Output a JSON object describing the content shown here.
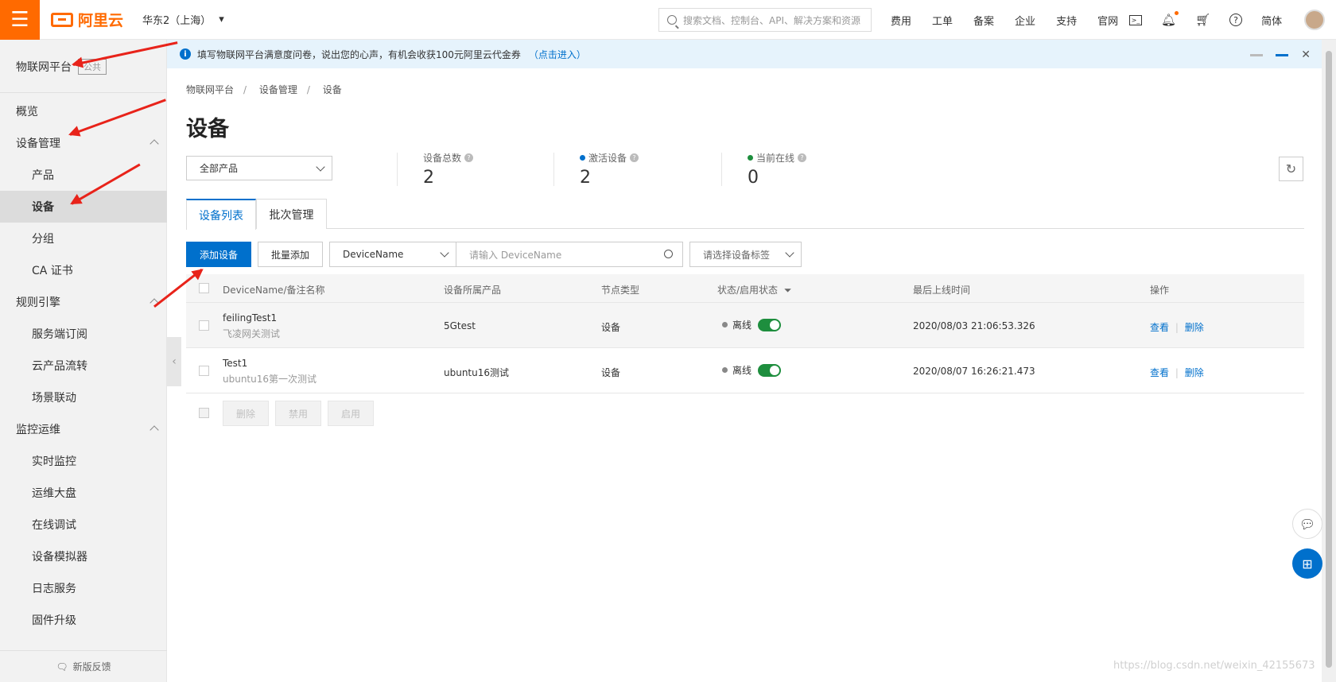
{
  "header": {
    "brand": "阿里云",
    "region": "华东2（上海）",
    "search_placeholder": "搜索文档、控制台、API、解决方案和资源",
    "nav": [
      "费用",
      "工单",
      "备案",
      "企业",
      "支持",
      "官网"
    ],
    "lang": "简体",
    "icons": [
      "terminal-icon",
      "bell-icon",
      "cart-icon",
      "help-icon"
    ]
  },
  "sidebar": {
    "title": "物联网平台",
    "tag": "公共",
    "items": [
      {
        "label": "概览",
        "level": 1
      },
      {
        "label": "设备管理",
        "level": 1,
        "expanded": true
      },
      {
        "label": "产品",
        "level": 2
      },
      {
        "label": "设备",
        "level": 2,
        "active": true
      },
      {
        "label": "分组",
        "level": 2
      },
      {
        "label": "CA 证书",
        "level": 2
      },
      {
        "label": "规则引擎",
        "level": 1,
        "expanded": true
      },
      {
        "label": "服务端订阅",
        "level": 2
      },
      {
        "label": "云产品流转",
        "level": 2
      },
      {
        "label": "场景联动",
        "level": 2
      },
      {
        "label": "监控运维",
        "level": 1,
        "expanded": true
      },
      {
        "label": "实时监控",
        "level": 2
      },
      {
        "label": "运维大盘",
        "level": 2
      },
      {
        "label": "在线调试",
        "level": 2
      },
      {
        "label": "设备模拟器",
        "level": 2
      },
      {
        "label": "日志服务",
        "level": 2
      },
      {
        "label": "固件升级",
        "level": 2
      }
    ],
    "feedback": "新版反馈"
  },
  "notice": {
    "text": "填写物联网平台满意度问卷，说出您的心声，有机会收获100元阿里云代金券",
    "link": "（点击进入）"
  },
  "breadcrumb": [
    "物联网平台",
    "设备管理",
    "设备"
  ],
  "page_title": "设备",
  "product_select": "全部产品",
  "stats": [
    {
      "label": "设备总数",
      "value": "2"
    },
    {
      "label": "激活设备",
      "value": "2",
      "dot_color": "#0070cc"
    },
    {
      "label": "当前在线",
      "value": "0",
      "dot_color": "#1e8e3e"
    }
  ],
  "tabs": [
    "设备列表",
    "批次管理"
  ],
  "toolbar": {
    "add_device": "添加设备",
    "batch_add": "批量添加",
    "filter_field": "DeviceName",
    "search_placeholder": "请输入 DeviceName",
    "tag_placeholder": "请选择设备标签"
  },
  "table": {
    "columns": [
      "DeviceName/备注名称",
      "设备所属产品",
      "节点类型",
      "状态/启用状态",
      "最后上线时间",
      "操作"
    ],
    "rows": [
      {
        "name": "feilingTest1",
        "note": "飞凌网关测试",
        "product": "5Gtest",
        "node": "设备",
        "status": "离线",
        "enabled": true,
        "last_online": "2020/08/03 21:06:53.326",
        "view": "查看",
        "delete": "删除"
      },
      {
        "name": "Test1",
        "note": "ubuntu16第一次测试",
        "product": "ubuntu16测试",
        "node": "设备",
        "status": "离线",
        "enabled": true,
        "last_online": "2020/08/07 16:26:21.473",
        "view": "查看",
        "delete": "删除"
      }
    ],
    "bulk_actions": [
      "删除",
      "禁用",
      "启用"
    ]
  },
  "watermark": "https://blog.csdn.net/weixin_42155673"
}
